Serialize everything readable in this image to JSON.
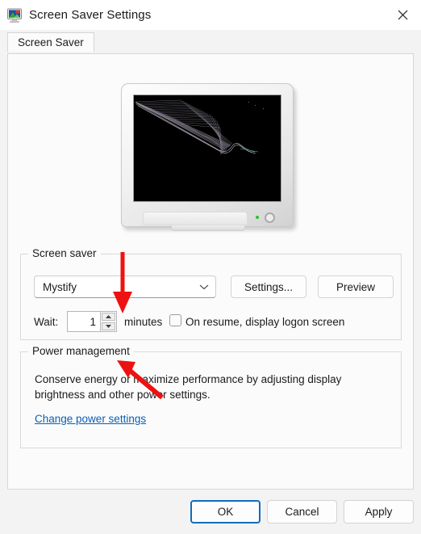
{
  "window": {
    "title": "Screen Saver Settings",
    "icon": "screen-saver-monitor-icon",
    "close_label": "✕"
  },
  "tabs": [
    {
      "label": "Screen Saver",
      "selected": true
    }
  ],
  "preview": {
    "name": "monitor-preview",
    "screen_content": "mystify-screensaver-pattern",
    "screen_background": "#000000"
  },
  "screen_saver_group": {
    "legend": "Screen saver",
    "combo": {
      "value": "Mystify",
      "chevron": "chevron-down-icon"
    },
    "settings_button": "Settings...",
    "preview_button": "Preview",
    "wait_label": "Wait:",
    "wait_value": "1",
    "minutes_label": "minutes",
    "resume_checkbox_checked": false,
    "resume_label": "On resume, display logon screen"
  },
  "power_group": {
    "legend": "Power management",
    "description": "Conserve energy or maximize performance by adjusting display brightness and other power settings.",
    "link": "Change power settings",
    "link_color": "#0a5fb3"
  },
  "dialog_buttons": [
    {
      "label": "OK",
      "default": true
    },
    {
      "label": "Cancel",
      "default": false
    },
    {
      "label": "Apply",
      "default": false
    }
  ],
  "annotations": {
    "color": "#ee1111",
    "arrow_down_target": "screen-saver-combobox",
    "arrow_up_target": "wait-spinner"
  }
}
